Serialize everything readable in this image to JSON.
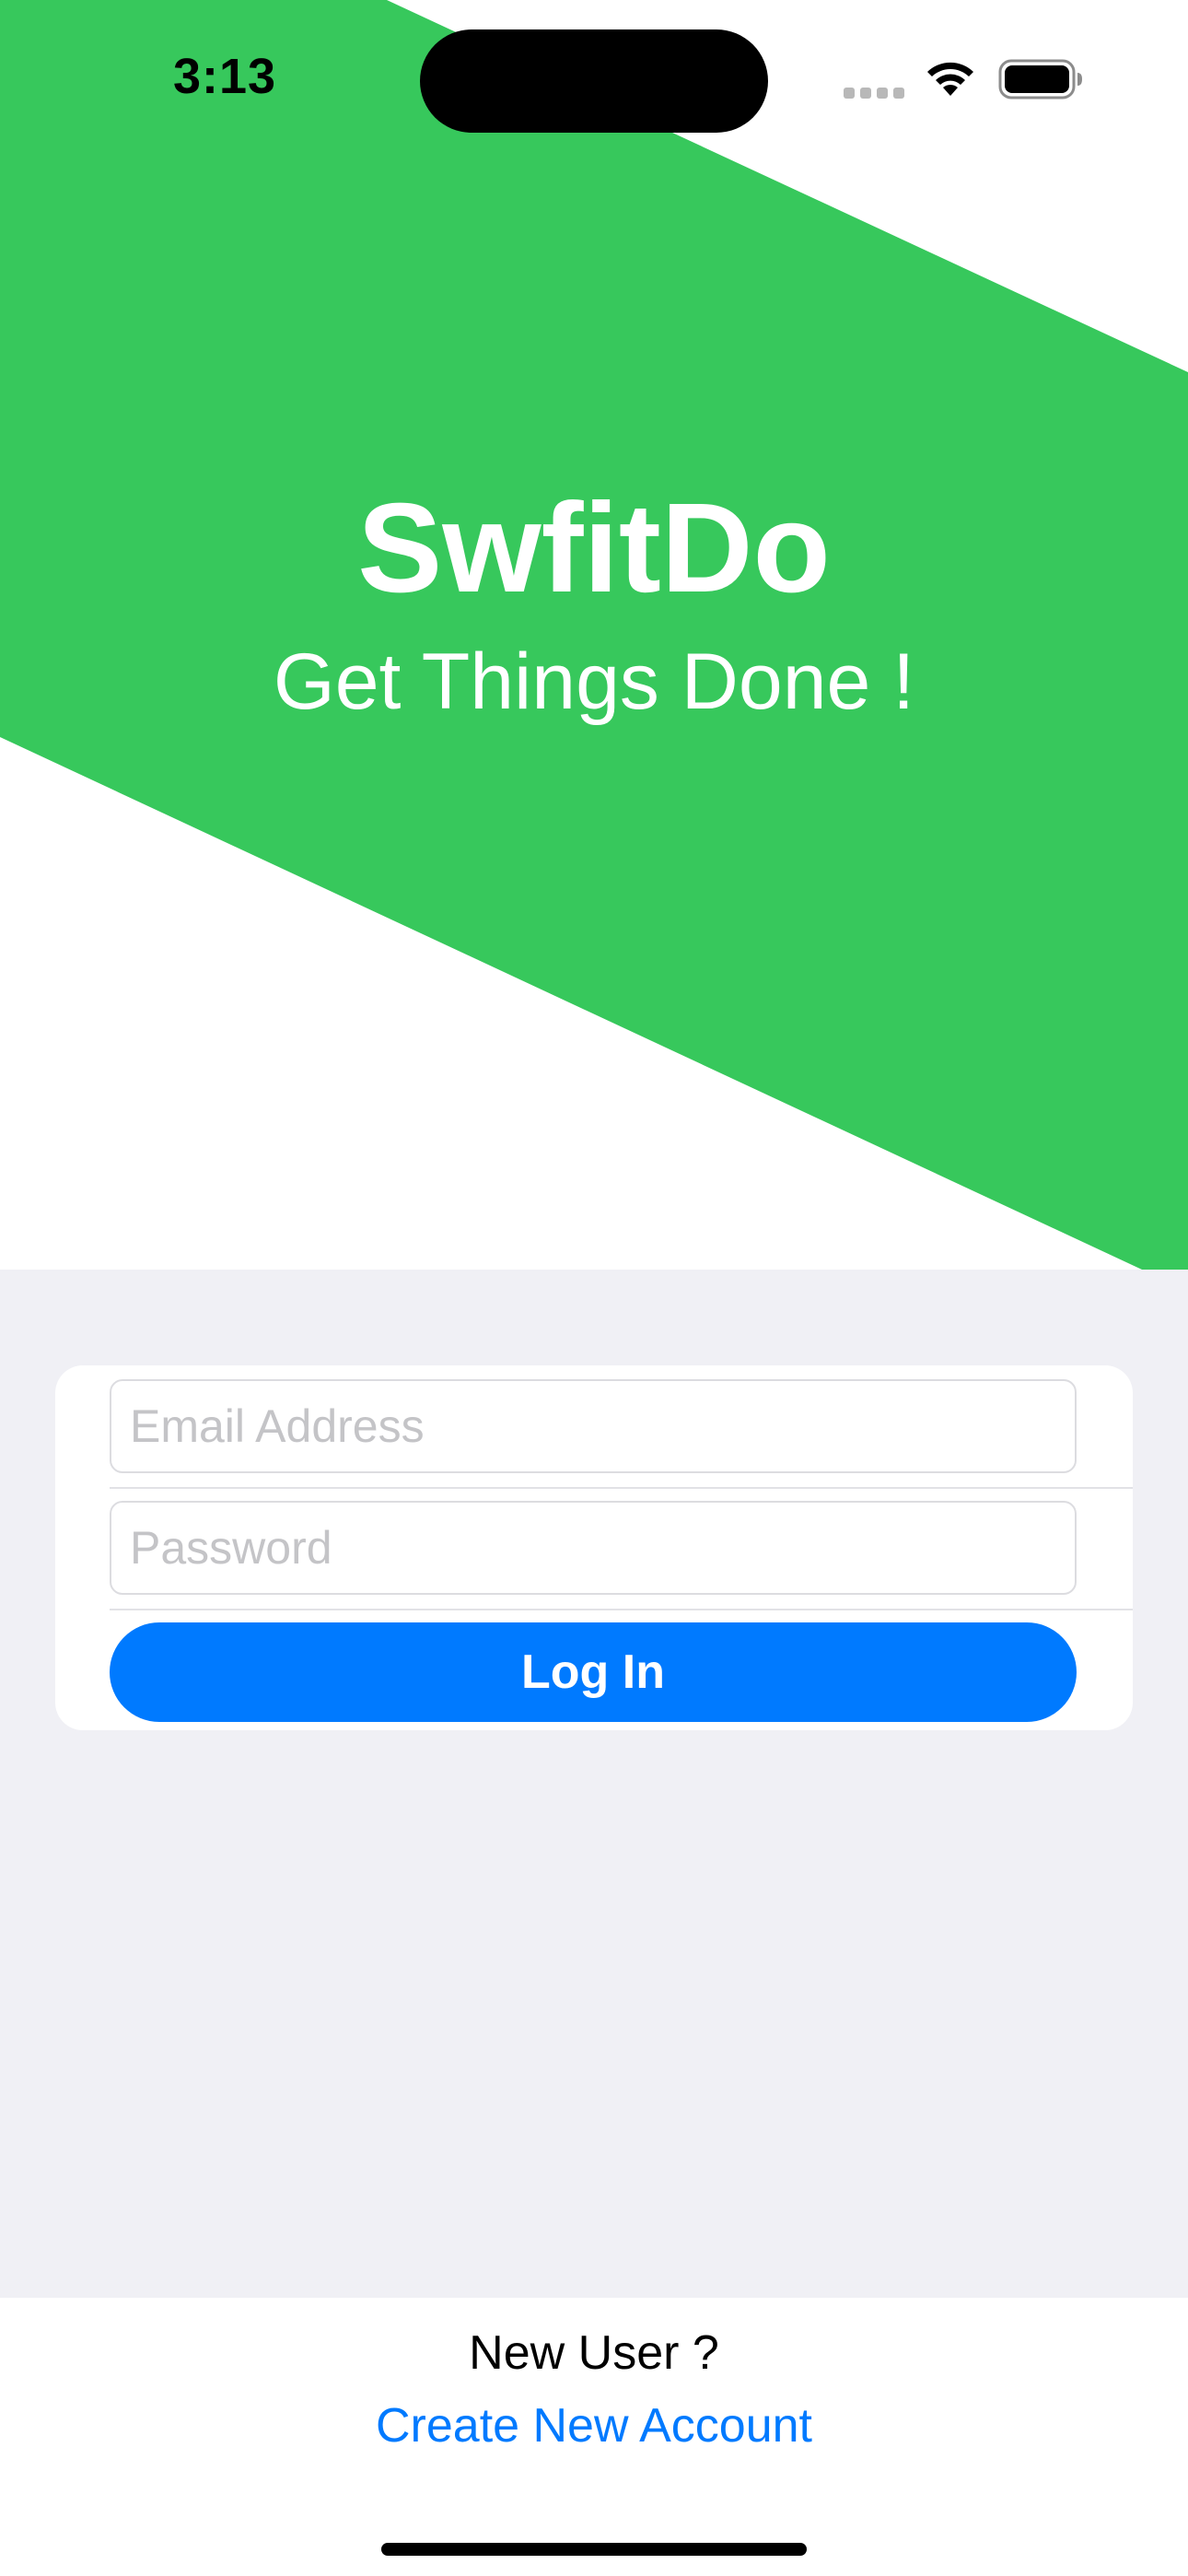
{
  "status_bar": {
    "time": "3:13"
  },
  "banner": {
    "color": "#37c85c",
    "title": "SwfitDo",
    "tagline": "Get Things Done !"
  },
  "login_form": {
    "email": {
      "placeholder": "Email Address",
      "value": ""
    },
    "password": {
      "placeholder": "Password",
      "value": ""
    },
    "login_label": "Log In"
  },
  "footer": {
    "new_user_label": "New User ?",
    "create_account_label": "Create New Account"
  },
  "colors": {
    "accent": "#007aff",
    "background": "#f0f0f5"
  },
  "icons": [
    "wifi-icon",
    "battery-icon",
    "signal-icon"
  ]
}
